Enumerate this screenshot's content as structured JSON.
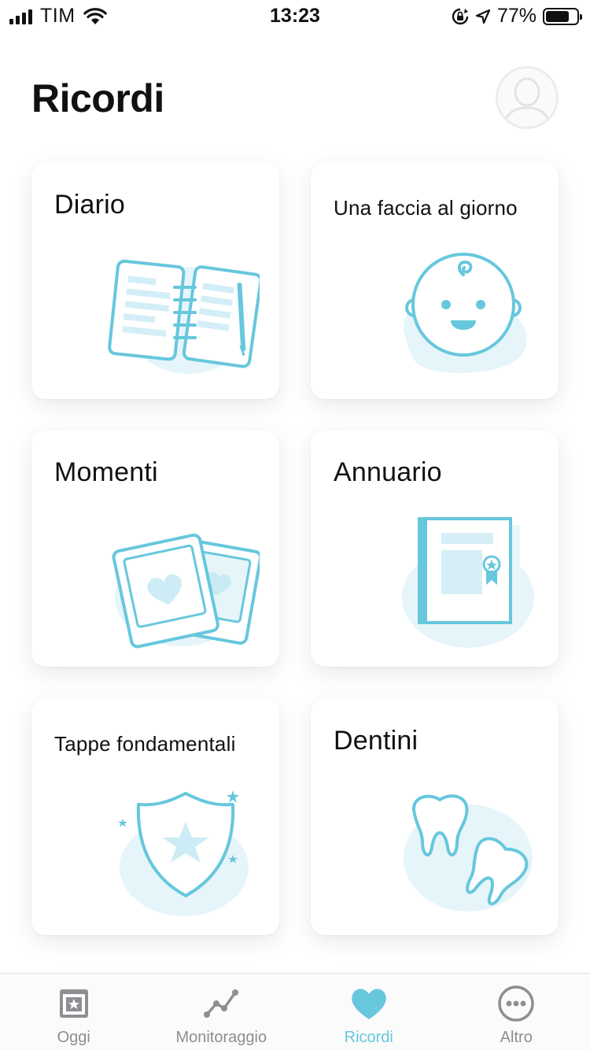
{
  "status_bar": {
    "carrier": "TIM",
    "time": "13:23",
    "battery_percent": "77%",
    "battery_level": 0.77,
    "icons": [
      "signal-icon",
      "wifi-icon",
      "orientation-lock-icon",
      "location-arrow-icon",
      "battery-icon"
    ]
  },
  "header": {
    "title": "Ricordi",
    "avatar_icon": "user-silhouette-icon"
  },
  "cards": [
    {
      "title": "Diario",
      "icon": "notebook-icon"
    },
    {
      "title": "Una faccia al giorno",
      "icon": "baby-face-icon"
    },
    {
      "title": "Momenti",
      "icon": "photos-heart-icon"
    },
    {
      "title": "Annuario",
      "icon": "yearbook-icon"
    },
    {
      "title": "Tappe fondamentali",
      "icon": "shield-star-icon"
    },
    {
      "title": "Dentini",
      "icon": "teeth-icon"
    }
  ],
  "tab_bar": {
    "active_tab": "Ricordi",
    "tabs": [
      {
        "label": "Oggi",
        "icon": "calendar-star-icon"
      },
      {
        "label": "Monitoraggio",
        "icon": "line-graph-icon"
      },
      {
        "label": "Ricordi",
        "icon": "heart-icon"
      },
      {
        "label": "Altro",
        "icon": "more-dots-icon"
      }
    ]
  },
  "colors": {
    "accent": "#67c7dd",
    "accent_light": "#e6f5fa",
    "tab_inactive": "#8e8e93",
    "text": "#111111"
  }
}
